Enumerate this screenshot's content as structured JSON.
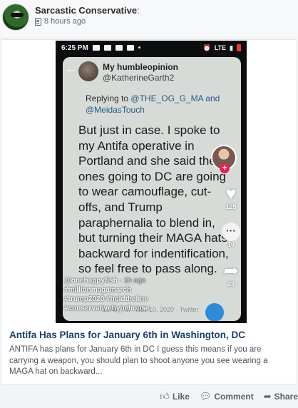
{
  "post": {
    "author": "Sarcastic Conservative",
    "author_suffix": ":",
    "time": "8 hours ago"
  },
  "screenshot": {
    "status": {
      "time": "6:25 PM",
      "dot": "•",
      "network": "LTE"
    },
    "tweet": {
      "name": "My humbleopinion",
      "handle": "@KatherineGarth2",
      "replying_prefix": "Replying to",
      "reply_mentions": "@THE_OG_G_MA and @MeidasTouch",
      "body": "But just in case. I spoke to my Antifa operative in Portland and she said the ones going to DC  are going to wear camouflage, cut-offs, and Trump paraphernalia to blend in, but turning their MAGA hats backward for indentification, so feel free to pass along.",
      "date": "10:42 PM · Nov 10, 2020 · Twitter"
    },
    "side": {
      "like_count": "125",
      "comment_count": "19",
      "share_count": "23"
    },
    "caption": {
      "user": "@onehappyfish",
      "ago": "· 1h ago",
      "tag1": "#millionmagamarch",
      "tag2": "#trump2020 #holdtheline",
      "tag3": "#conservativehypehouse"
    }
  },
  "link": {
    "headline": "Antifa Has Plans for January 6th in Washington, DC",
    "excerpt": "ANTIFA has plans for January 6th in DC I guess this means if you are carrying a weapon, you should plan to shoot anyone you see wearing a MAGA hat on backward..."
  },
  "actions": {
    "like": "Like",
    "comment": "Comment",
    "share": "Share"
  },
  "icons": {
    "post_type": "document-icon",
    "like": "thumbs-up-icon",
    "comment": "speech-bubble-icon",
    "share": "share-arrow-icon"
  }
}
